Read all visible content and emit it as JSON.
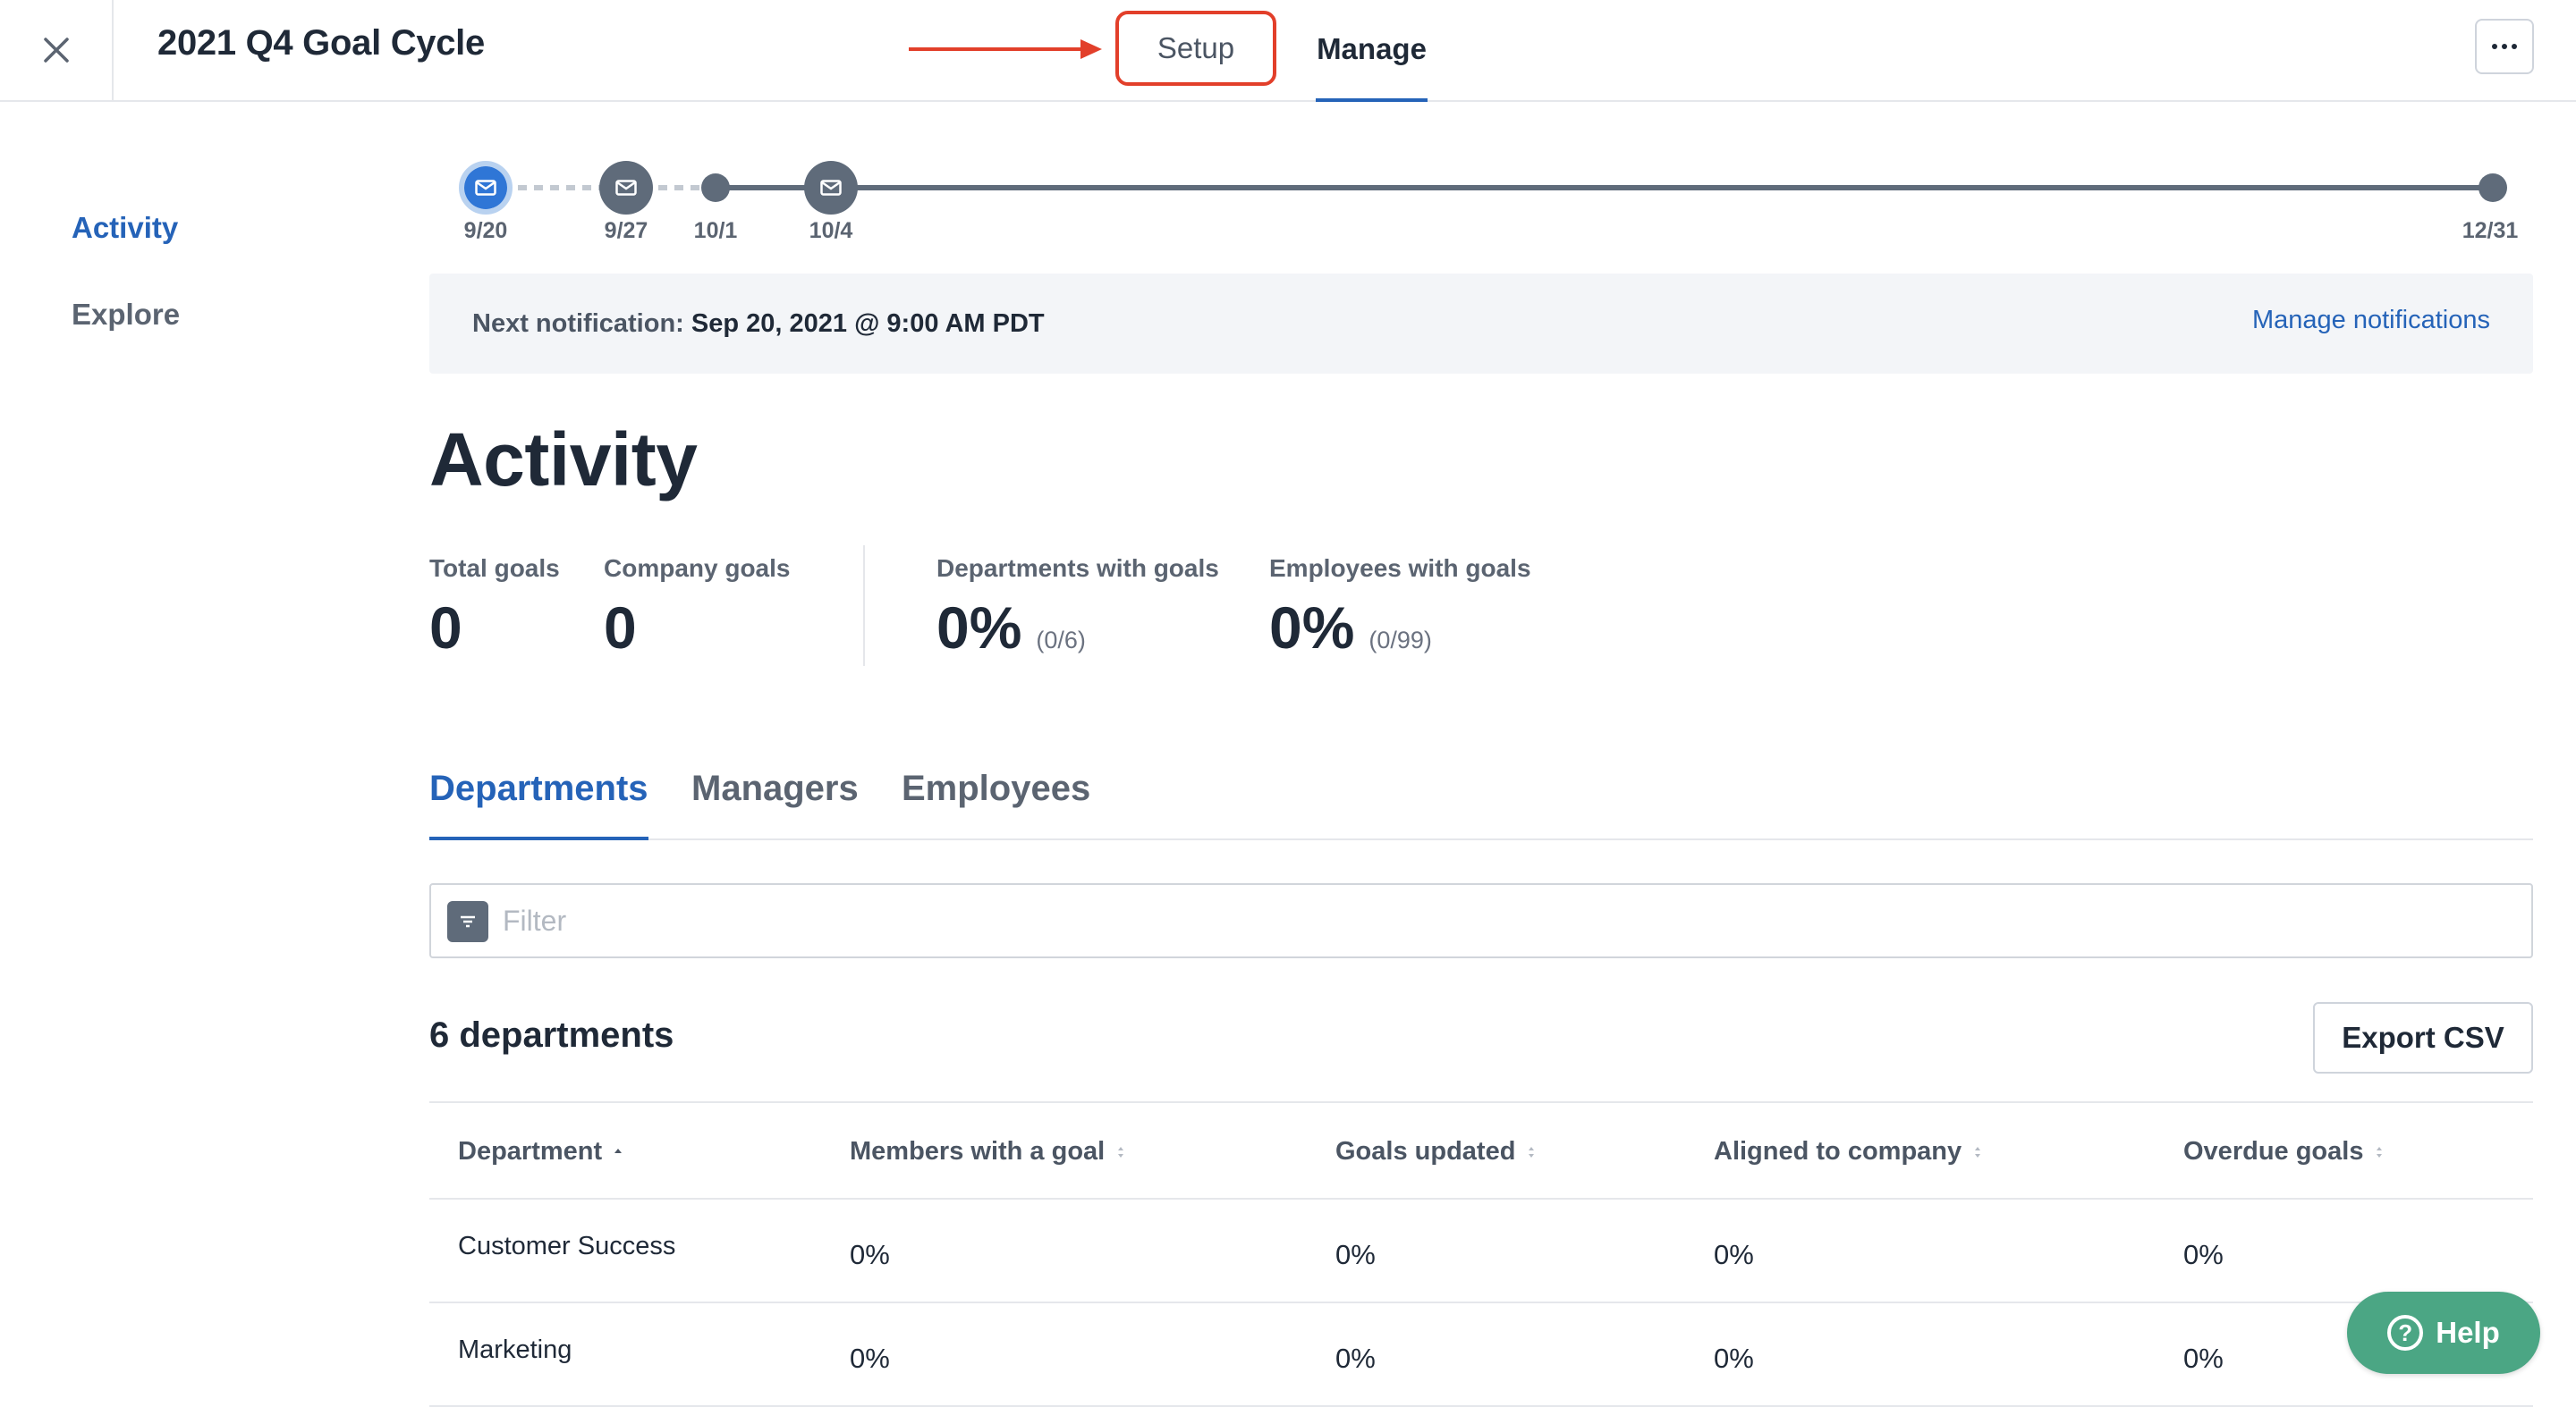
{
  "header": {
    "title": "2021 Q4 Goal Cycle",
    "tabs": [
      {
        "label": "Setup",
        "active": false,
        "highlighted": true
      },
      {
        "label": "Manage",
        "active": true
      }
    ],
    "close_icon": "close-icon",
    "more_icon": "more-horizontal-icon"
  },
  "nav": {
    "items": [
      {
        "label": "Activity",
        "active": true
      },
      {
        "label": "Explore",
        "active": false
      }
    ]
  },
  "timeline": {
    "nodes": [
      {
        "date": "9/20",
        "icon": "mail-icon",
        "current": true
      },
      {
        "date": "9/27",
        "icon": "mail-icon"
      },
      {
        "date": "10/1",
        "icon": "dot"
      },
      {
        "date": "10/4",
        "icon": "mail-icon"
      },
      {
        "date": "12/31",
        "icon": "dot"
      }
    ]
  },
  "notification": {
    "label": "Next notification:",
    "value": "Sep 20, 2021 @ 9:00 AM PDT",
    "link": "Manage notifications"
  },
  "activity": {
    "heading": "Activity",
    "stats": [
      {
        "label": "Total goals",
        "value": "0",
        "sub": ""
      },
      {
        "label": "Company goals",
        "value": "0",
        "sub": ""
      },
      {
        "label": "Departments with goals",
        "value": "0%",
        "sub": "(0/6)"
      },
      {
        "label": "Employees with goals",
        "value": "0%",
        "sub": "(0/99)"
      }
    ]
  },
  "subtabs": [
    {
      "label": "Departments",
      "active": true
    },
    {
      "label": "Managers",
      "active": false
    },
    {
      "label": "Employees",
      "active": false
    }
  ],
  "filter": {
    "placeholder": "Filter",
    "value": "",
    "icon": "filter-icon"
  },
  "departments": {
    "count_label": "6 departments",
    "export_label": "Export CSV",
    "columns": [
      "Department",
      "Members with a goal",
      "Goals updated",
      "Aligned to company",
      "Overdue goals"
    ],
    "rows": [
      [
        "Customer Success",
        "0%",
        "0%",
        "0%",
        "0%"
      ],
      [
        "Marketing",
        "0%",
        "0%",
        "0%",
        "0%"
      ]
    ]
  },
  "help": {
    "label": "Help",
    "icon": "question-icon"
  },
  "colors": {
    "accent": "#2563b8",
    "annotation": "#e23f2a",
    "help": "#4ba684",
    "timeline": "#5f6b7a"
  }
}
